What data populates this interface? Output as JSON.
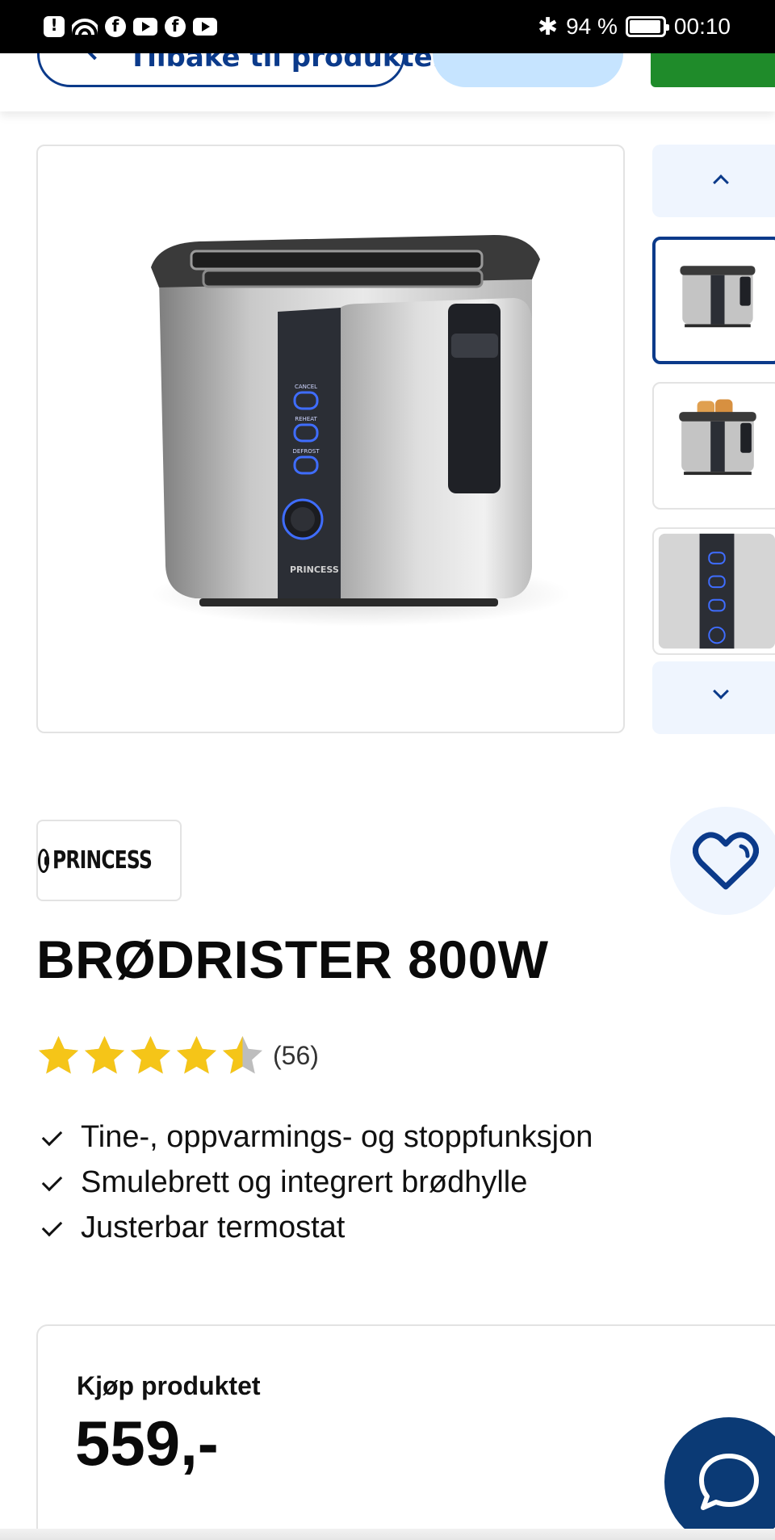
{
  "status_bar": {
    "battery_percent": "94 %",
    "battery_level": 0.94,
    "time": "00:10",
    "left_icons": [
      "alert-icon",
      "wifi-icon",
      "facebook-icon",
      "youtube-icon",
      "facebook-icon",
      "youtube-icon"
    ],
    "right_icons": [
      "bluetooth-icon",
      "battery-icon"
    ]
  },
  "nav": {
    "back_label": "Tilbake til produkter"
  },
  "gallery": {
    "thumbnail_count": 3,
    "active_thumbnail": 0,
    "icons": [
      "chevron-up-icon",
      "chevron-down-icon"
    ]
  },
  "product": {
    "brand": "PRINCESS",
    "title": "BRØDRISTER 800W",
    "rating": 4.5,
    "rating_max": 5,
    "rating_count": "(56)",
    "features": [
      "Tine-, oppvarmings- og stoppfunksjon",
      "Smulebrett og integrert brødhylle",
      "Justerbar termostat"
    ],
    "control_labels": [
      "CANCEL",
      "REHEAT",
      "DEFROST"
    ]
  },
  "buy": {
    "label": "Kjøp produktet",
    "price": "559,-"
  },
  "colors": {
    "primary": "#0b3a8a",
    "chat_bg": "#0b3a75",
    "light_blue": "#eff5fe",
    "pill_blue": "#c6e4ff",
    "green": "#1f8b2a",
    "star": "#f5c518",
    "star_empty": "#bdbdbd"
  }
}
